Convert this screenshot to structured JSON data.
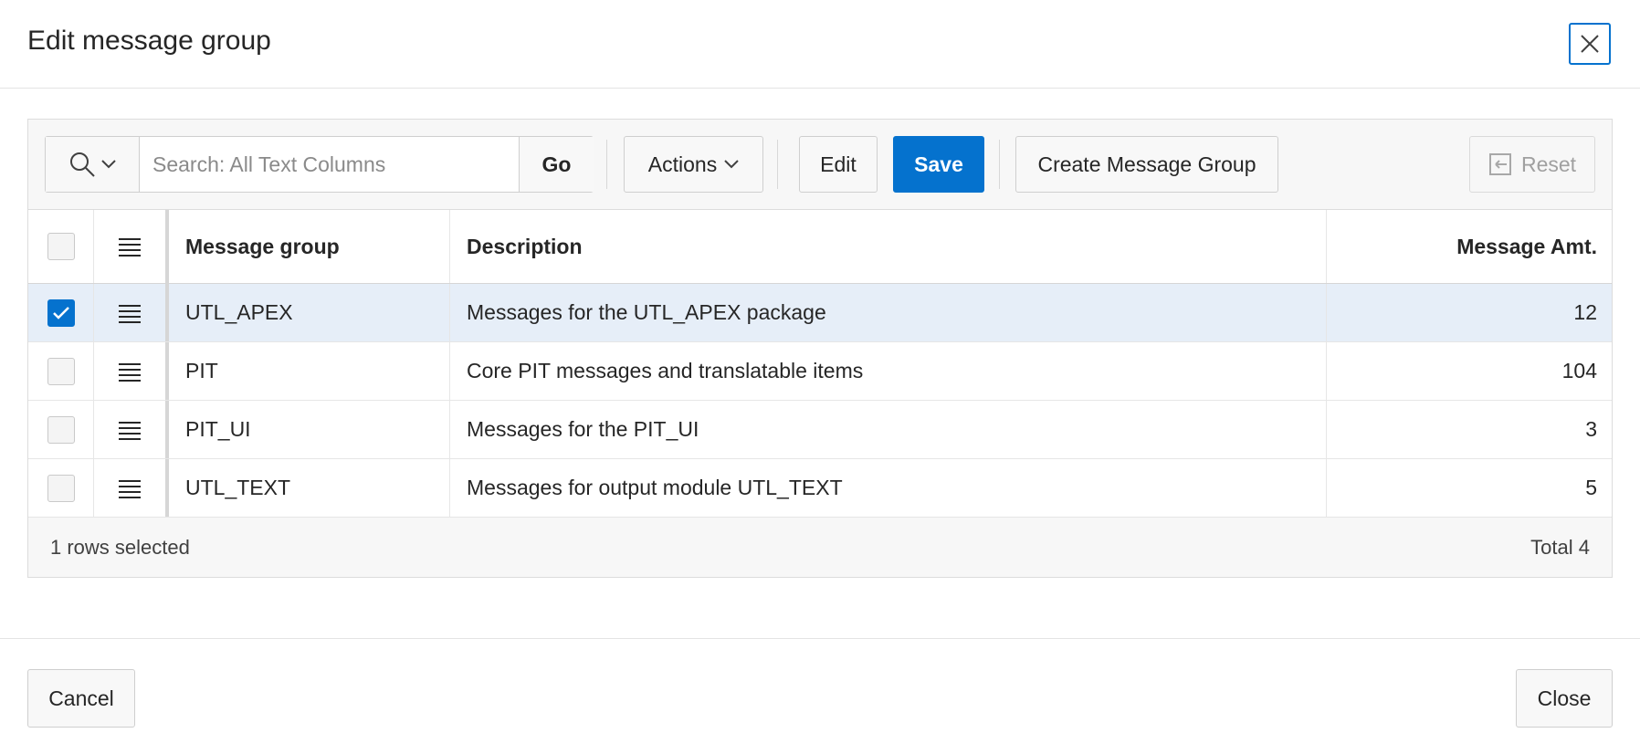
{
  "dialog": {
    "title": "Edit message group",
    "close_icon": "close-icon"
  },
  "toolbar": {
    "search_icon": "search-icon",
    "search_placeholder": "Search: All Text Columns",
    "search_value": "",
    "go_label": "Go",
    "actions_label": "Actions",
    "edit_label": "Edit",
    "save_label": "Save",
    "create_label": "Create Message Group",
    "reset_label": "Reset"
  },
  "grid": {
    "columns": [
      "Message group",
      "Description",
      "Message Amt."
    ],
    "rows": [
      {
        "group": "UTL_APEX",
        "description": "Messages for the UTL_APEX package",
        "amount": "12",
        "selected": true
      },
      {
        "group": "PIT",
        "description": "Core PIT messages and translatable items",
        "amount": "104",
        "selected": false
      },
      {
        "group": "PIT_UI",
        "description": "Messages for the PIT_UI",
        "amount": "3",
        "selected": false
      },
      {
        "group": "UTL_TEXT",
        "description": "Messages for output module UTL_TEXT",
        "amount": "5",
        "selected": false
      }
    ],
    "footer": {
      "selected_text": "1 rows selected",
      "total_text": "Total 4"
    }
  },
  "footer": {
    "cancel_label": "Cancel",
    "close_label": "Close"
  },
  "colors": {
    "accent": "#0572ce",
    "selected_row": "#e6eef8"
  }
}
